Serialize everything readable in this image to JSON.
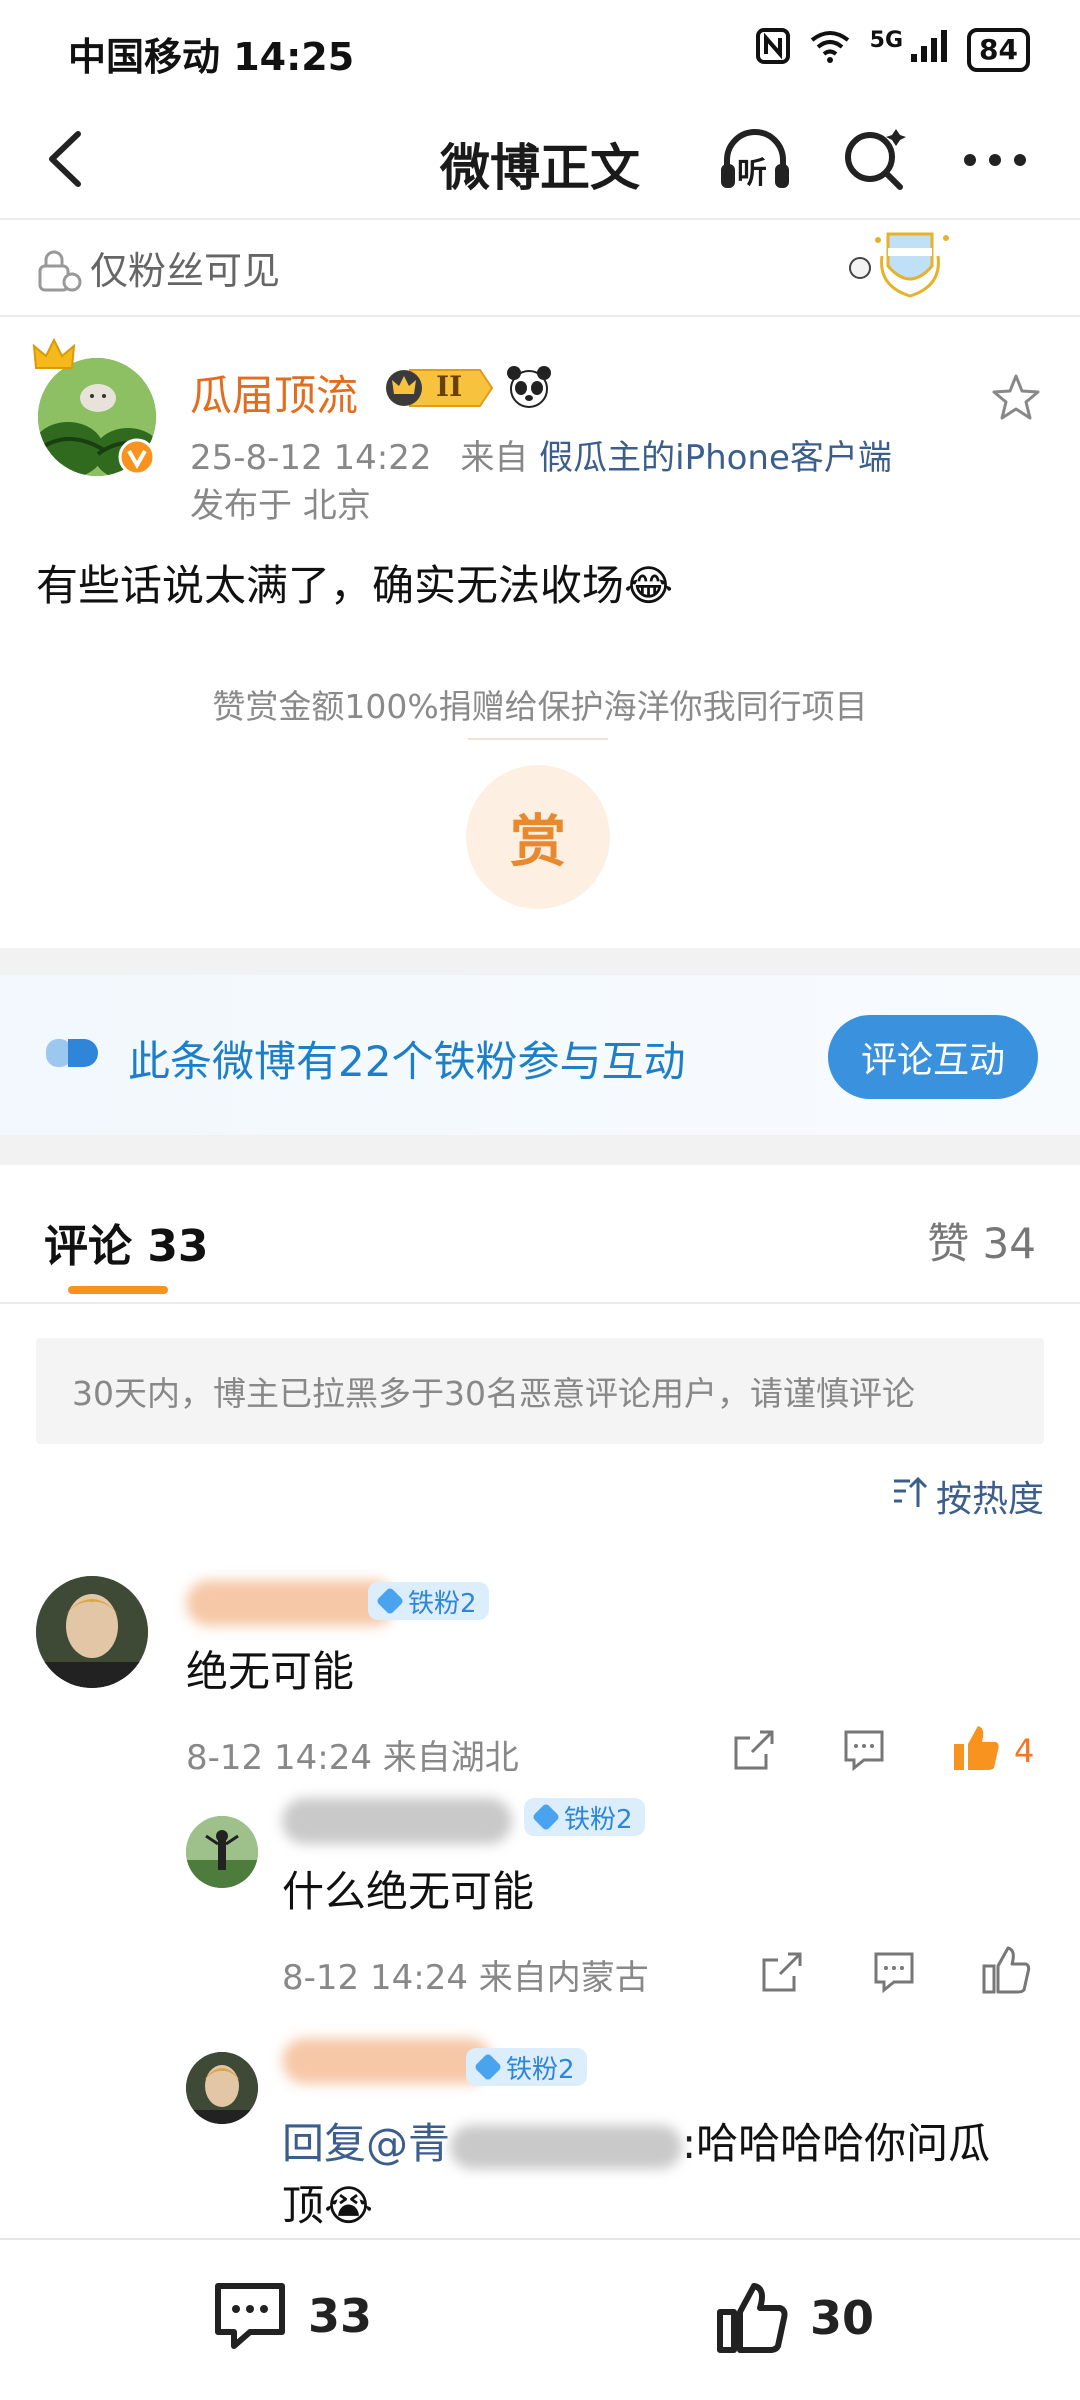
{
  "status_bar": {
    "carrier_time": "中国移动 14:25",
    "network": "5G",
    "battery": "84"
  },
  "nav": {
    "title": "微博正文",
    "listen_label": "听"
  },
  "visibility": {
    "label": "仅粉丝可见"
  },
  "post": {
    "author": "瓜届顶流",
    "member_level": "II",
    "date": "25-8-12 14:22",
    "source_prefix": "来自",
    "source": "假瓜主的iPhone客户端",
    "location": "发布于 北京",
    "body": "有些话说太满了，确实无法收场😂",
    "reward_note": "赞赏金额100%捐赠给保护海洋你我同行项目",
    "reward_button": "赏"
  },
  "fans_banner": {
    "text": "此条微博有22个铁粉参与互动",
    "button": "评论互动"
  },
  "tabs": {
    "comments": "评论 33",
    "likes": "赞 34"
  },
  "notice": "30天内，博主已拉黑多于30名恶意评论用户，请谨慎评论",
  "sort": {
    "label": "按热度"
  },
  "comments": [
    {
      "badge": "铁粉2",
      "text": "绝无可能",
      "meta": "8-12 14:24 来自湖北",
      "likes": "4"
    },
    {
      "badge": "铁粉2",
      "text": "什么绝无可能",
      "meta": "8-12 14:24 来自内蒙古"
    },
    {
      "badge": "铁粉2",
      "text_line1": "回复@青",
      "text_line1_tail": ":哈哈哈哈你问瓜",
      "text_line2": "顶😭"
    }
  ],
  "bottom_bar": {
    "comments": "33",
    "likes": "30"
  },
  "colors": {
    "accent_orange": "#f7931e",
    "link_blue": "#3b5e8c",
    "fans_blue": "#1e7fc9"
  }
}
